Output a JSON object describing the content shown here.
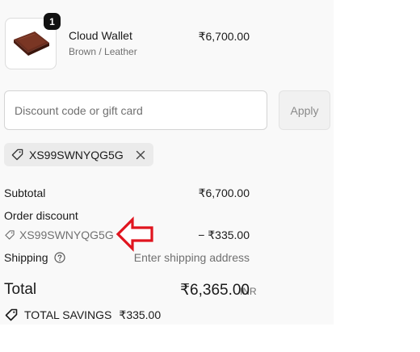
{
  "product": {
    "name": "Cloud Wallet",
    "variant": "Brown / Leather",
    "price": "₹6,700.00",
    "quantity": "1",
    "image_icon": "wallet-icon"
  },
  "discount": {
    "placeholder": "Discount code or gift card",
    "apply_label": "Apply",
    "applied_code": "XS99SWNYQG5G"
  },
  "summary": {
    "subtotal_label": "Subtotal",
    "subtotal_value": "₹6,700.00",
    "order_discount_label": "Order discount",
    "discount_code": "XS99SWNYQG5G",
    "discount_value": "− ₹335.00",
    "shipping_label": "Shipping",
    "shipping_value": "Enter shipping address",
    "total_label": "Total",
    "currency": "INR",
    "total_value": "₹6,365.00",
    "savings_label": "TOTAL SAVINGS",
    "savings_value": "₹335.00"
  },
  "colors": {
    "panel_bg": "#f9f9f9",
    "annotation_arrow": "#e0141e",
    "muted_text": "#707070"
  }
}
